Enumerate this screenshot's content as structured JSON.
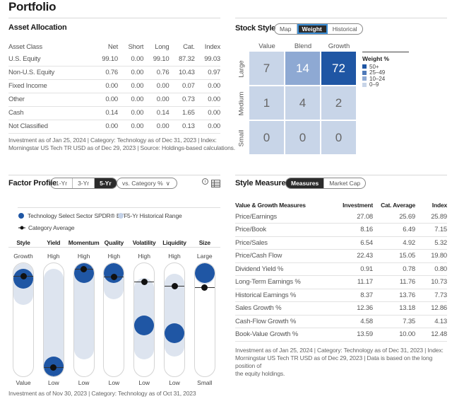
{
  "page_title": "Portfolio",
  "asset_allocation": {
    "title": "Asset Allocation",
    "columns": [
      "Asset Class",
      "Net",
      "Short",
      "Long",
      "Cat.",
      "Index"
    ],
    "rows": [
      [
        "U.S. Equity",
        "99.10",
        "0.00",
        "99.10",
        "87.32",
        "99.03"
      ],
      [
        "Non-U.S. Equity",
        "0.76",
        "0.00",
        "0.76",
        "10.43",
        "0.97"
      ],
      [
        "Fixed Income",
        "0.00",
        "0.00",
        "0.00",
        "0.07",
        "0.00"
      ],
      [
        "Other",
        "0.00",
        "0.00",
        "0.00",
        "0.73",
        "0.00"
      ],
      [
        "Cash",
        "0.14",
        "0.00",
        "0.14",
        "1.65",
        "0.00"
      ],
      [
        "Not Classified",
        "0.00",
        "0.00",
        "0.00",
        "0.13",
        "0.00"
      ]
    ],
    "footnote_line1": "Investment as of Jan 25, 2024 | Category: Technology as of Dec 31, 2023 | Index:",
    "footnote_line2": "Morningstar US Tech TR USD as of Dec 29, 2023 | Source: Holdings-based calculations."
  },
  "stock_style": {
    "title": "Stock Style",
    "tabs": [
      {
        "label": "Map",
        "active": false
      },
      {
        "label": "Weight",
        "active": true
      },
      {
        "label": "Historical",
        "active": false
      }
    ],
    "col_labels": [
      "Value",
      "Blend",
      "Growth"
    ],
    "row_labels": [
      "Large",
      "Medium",
      "Small"
    ],
    "cells": [
      [
        7,
        14,
        72
      ],
      [
        1,
        4,
        2
      ],
      [
        0,
        0,
        0
      ]
    ],
    "legend": {
      "title": "Weight %",
      "items": [
        {
          "label": "50+",
          "color": "#1f56a4"
        },
        {
          "label": "25–49",
          "color": "#4f79b9"
        },
        {
          "label": "10–24",
          "color": "#8ea9d3"
        },
        {
          "label": "0–9",
          "color": "#c8d5e8"
        }
      ]
    }
  },
  "factor_profile": {
    "title": "Factor Profile",
    "period_tabs": [
      {
        "label": "1-Yr",
        "active": false
      },
      {
        "label": "3-Yr",
        "active": false
      },
      {
        "label": "5-Yr",
        "active": true
      }
    ],
    "compare_dropdown": "vs. Category %",
    "info_icon": "info-icon",
    "table_icon": "table-view-icon",
    "legend": {
      "fund": "Technology Select Sector SPDR® ETF",
      "range": "5-Yr Historical Range",
      "category": "Category Average"
    },
    "colors": {
      "fund": "#1f56a4",
      "range": "#dde4ef",
      "category": "#111111"
    },
    "factors": [
      {
        "name": "Style",
        "high": "Growth",
        "low": "Value",
        "fund_pct": 86,
        "cat_pct": 89,
        "range": [
          72,
          95
        ]
      },
      {
        "name": "Yield",
        "high": "High",
        "low": "Low",
        "fund_pct": 8,
        "cat_pct": 8,
        "range": [
          2,
          86
        ]
      },
      {
        "name": "Momentum",
        "high": "High",
        "low": "Low",
        "fund_pct": 93,
        "cat_pct": 95,
        "range": [
          24,
          97
        ]
      },
      {
        "name": "Quality",
        "high": "High",
        "low": "Low",
        "fund_pct": 92,
        "cat_pct": 88,
        "range": [
          77,
          98
        ]
      },
      {
        "name": "Volatility",
        "high": "High",
        "low": "Low",
        "fund_pct": 45,
        "cat_pct": 84,
        "range": [
          24,
          78
        ]
      },
      {
        "name": "Liquidity",
        "high": "High",
        "low": "Low",
        "fund_pct": 38,
        "cat_pct": 80,
        "range": [
          26,
          82
        ]
      },
      {
        "name": "Size",
        "high": "Large",
        "low": "Small",
        "fund_pct": 94,
        "cat_pct": 79,
        "range": [
          90,
          99
        ]
      }
    ],
    "footnote": "Investment as of Nov 30, 2023 | Category: Technology as of Oct 31, 2023"
  },
  "style_measures": {
    "title": "Style Measures",
    "tabs": [
      {
        "label": "Measures",
        "active": true
      },
      {
        "label": "Market Cap",
        "active": false
      }
    ],
    "columns": [
      "Value & Growth Measures",
      "Investment",
      "Cat. Average",
      "Index"
    ],
    "rows": [
      [
        "Price/Earnings",
        "27.08",
        "25.69",
        "25.89"
      ],
      [
        "Price/Book",
        "8.16",
        "6.49",
        "7.15"
      ],
      [
        "Price/Sales",
        "6.54",
        "4.92",
        "5.32"
      ],
      [
        "Price/Cash Flow",
        "22.43",
        "15.05",
        "19.80"
      ],
      [
        "Dividend Yield %",
        "0.91",
        "0.78",
        "0.80"
      ],
      [
        "Long-Term Earnings %",
        "11.17",
        "11.76",
        "10.73"
      ],
      [
        "Historical Earnings %",
        "8.37",
        "13.76",
        "7.73"
      ],
      [
        "Sales Growth %",
        "12.36",
        "13.18",
        "12.86"
      ],
      [
        "Cash-Flow Growth %",
        "4.58",
        "7.35",
        "4.13"
      ],
      [
        "Book-Value Growth %",
        "13.59",
        "10.00",
        "12.48"
      ]
    ],
    "footnote_line1": "Investment as of Jan 25, 2024 | Category: Technology as of Dec 31, 2023 | Index:",
    "footnote_line2": "Morningstar US Tech TR USD as of Dec 29, 2023 | Data is based on the long position of",
    "footnote_line3": "the equity holdings."
  }
}
